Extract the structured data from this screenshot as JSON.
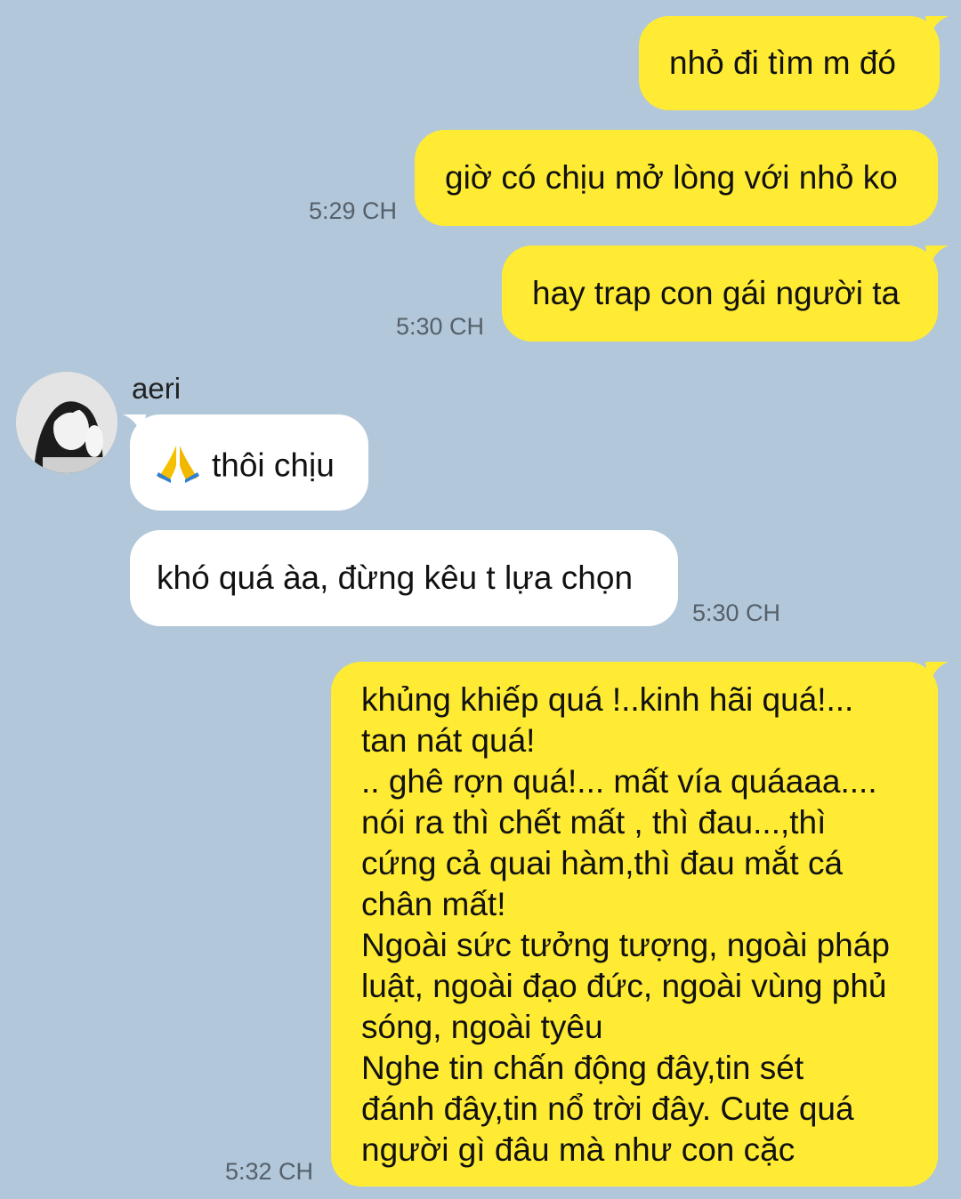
{
  "chat": {
    "messages": [
      {
        "from": "me",
        "text": "nhỏ đi tìm m đó"
      },
      {
        "from": "me",
        "text": "giờ có chịu mở lòng với nhỏ ko",
        "time": "5:29 CH"
      },
      {
        "from": "me",
        "text": "hay trap con gái người ta",
        "time": "5:30 CH"
      },
      {
        "from": "them",
        "sender": "aeri",
        "text": "thôi chịu",
        "emoji": "folded-hands-emoji"
      },
      {
        "from": "them",
        "text": "khó quá àa, đừng kêu t lựa chọn",
        "time": "5:30 CH"
      },
      {
        "from": "me",
        "text": "khủng khiếp quá !..kinh hãi quá!...\ntan nát quá!\n.. ghê rợn quá!... mất vía quáaaa....\nnói ra thì chết mất , thì đau...,thì\ncứng cả quai hàm,thì đau mắt cá\nchân mất!\nNgoài sức tưởng tượng, ngoài pháp\nluật, ngoài đạo đức, ngoài vùng phủ\nsóng, ngoài tyêu\nNghe tin chấn động đây,tin sét\nđánh đây,tin nổ trời đây. Cute quá\nngười gì đâu mà như con cặc",
        "time": "5:32 CH"
      }
    ]
  },
  "colors": {
    "background": "#b2c7da",
    "my_bubble": "#ffeb33",
    "their_bubble": "#ffffff",
    "timestamp": "#55606a"
  }
}
